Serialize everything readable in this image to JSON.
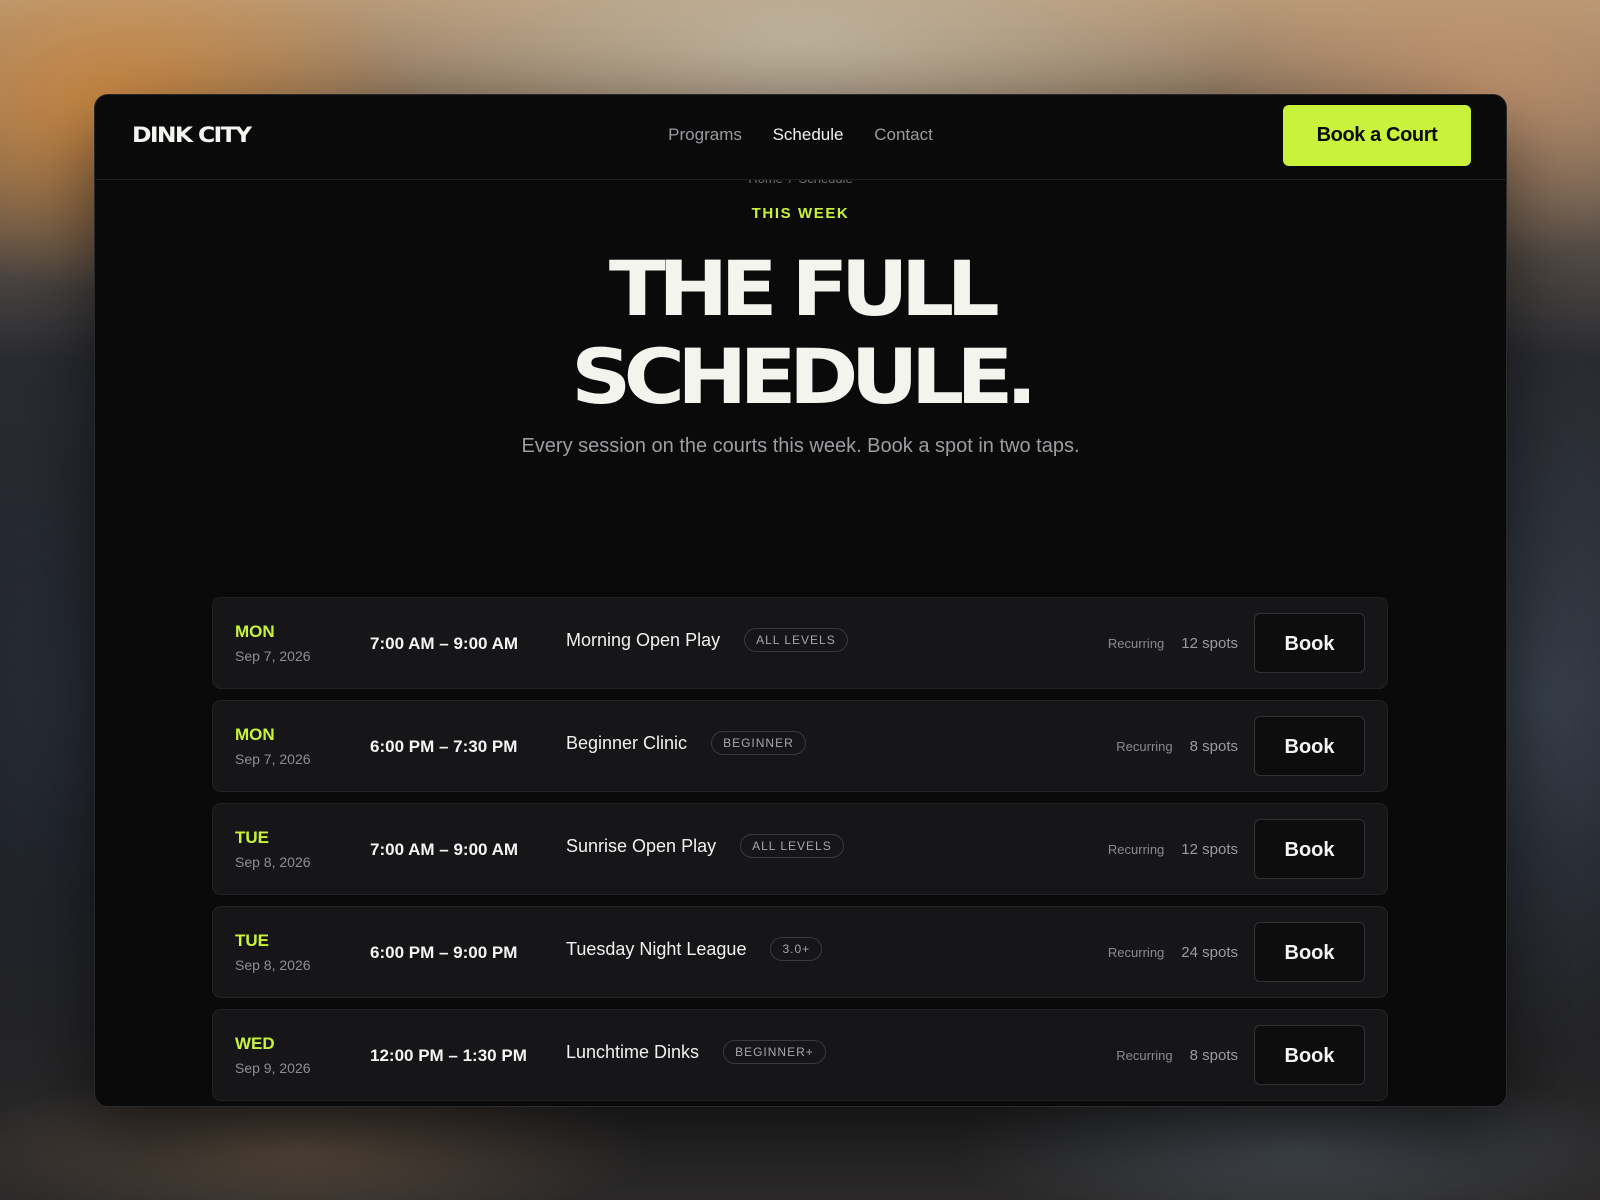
{
  "nav": {
    "logo": "DINK CITY",
    "links": [
      "Programs",
      "Schedule",
      "Contact"
    ],
    "active": "Schedule",
    "cta": "Book a Court"
  },
  "breadcrumb": {
    "home": "Home",
    "separator": "/",
    "current": "Schedule"
  },
  "hero": {
    "eyebrow": "THIS WEEK",
    "title_line1": "THE FULL",
    "title_line2": "SCHEDULE.",
    "subtitle": "Every session on the courts this week. Book a spot in two taps."
  },
  "colors": {
    "accent": "#c8f23c",
    "background": "#0a0a0b",
    "card": "#161618"
  },
  "sessions": [
    {
      "day": "MON",
      "date": "Sep 7, 2026",
      "time": "7:00 AM – 9:00 AM",
      "title": "Morning Open Play",
      "level": "ALL LEVELS",
      "recurring": "Recurring",
      "spots": "12 spots",
      "button": "Book"
    },
    {
      "day": "MON",
      "date": "Sep 7, 2026",
      "time": "6:00 PM – 7:30 PM",
      "title": "Beginner Clinic",
      "level": "BEGINNER",
      "recurring": "Recurring",
      "spots": "8 spots",
      "button": "Book"
    },
    {
      "day": "TUE",
      "date": "Sep 8, 2026",
      "time": "7:00 AM – 9:00 AM",
      "title": "Sunrise Open Play",
      "level": "ALL LEVELS",
      "recurring": "Recurring",
      "spots": "12 spots",
      "button": "Book"
    },
    {
      "day": "TUE",
      "date": "Sep 8, 2026",
      "time": "6:00 PM – 9:00 PM",
      "title": "Tuesday Night League",
      "level": "3.0+",
      "recurring": "Recurring",
      "spots": "24 spots",
      "button": "Book"
    },
    {
      "day": "WED",
      "date": "Sep 9, 2026",
      "time": "12:00 PM – 1:30 PM",
      "title": "Lunchtime Dinks",
      "level": "BEGINNER+",
      "recurring": "Recurring",
      "spots": "8 spots",
      "button": "Book"
    }
  ]
}
